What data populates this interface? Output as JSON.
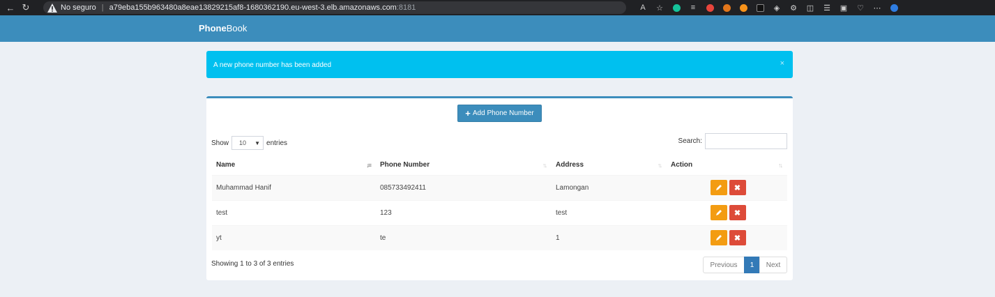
{
  "browser": {
    "security_label": "No seguro",
    "url_host": "a79eba155b963480a8eae13829215af8-1680362190.eu-west-3.elb.amazonaws.com",
    "url_port": ":8181"
  },
  "app": {
    "brand_bold": "Phone",
    "brand_rest": "Book"
  },
  "alert": {
    "message": "A new phone number has been added",
    "close": "×"
  },
  "toolbar": {
    "add_label": "Add Phone Number"
  },
  "table_controls": {
    "show_label": "Show",
    "entries_label": "entries",
    "page_length": "10",
    "search_label": "Search:"
  },
  "table": {
    "headers": [
      "Name",
      "Phone Number",
      "Address",
      "Action"
    ],
    "rows": [
      {
        "name": "Muhammad Hanif",
        "phone": "085733492411",
        "address": "Lamongan"
      },
      {
        "name": "test",
        "phone": "123",
        "address": "test"
      },
      {
        "name": "yt",
        "phone": "te",
        "address": "1"
      }
    ]
  },
  "footer": {
    "info": "Showing 1 to 3 of 3 entries",
    "previous": "Previous",
    "current_page": "1",
    "next": "Next"
  },
  "colors": {
    "header": "#3c8dbc",
    "alert": "#00c0ef",
    "edit": "#f39c12",
    "delete": "#dd4b39"
  }
}
